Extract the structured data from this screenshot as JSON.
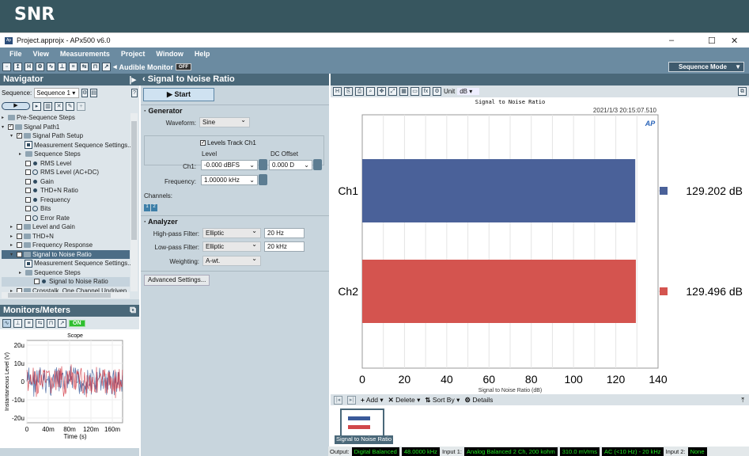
{
  "banner": "SNR",
  "window": {
    "title": "Project.approjx - APx500 v6.0",
    "app_icon": "Ap",
    "min": "–",
    "max": "☐",
    "close": "✕"
  },
  "menu": [
    "File",
    "View",
    "Measurements",
    "Project",
    "Window",
    "Help"
  ],
  "toolbar": {
    "audible_monitor": "Audible Monitor",
    "audible_state": "OFF",
    "mode": "Sequence Mode"
  },
  "navigator": {
    "title": "Navigator",
    "sequence_label": "Sequence:",
    "sequence_value": "Sequence 1",
    "tree": [
      {
        "label": "Pre-Sequence Steps",
        "indent": 0,
        "type": "folder",
        "exp": "▸"
      },
      {
        "label": "Signal Path1",
        "indent": 0,
        "type": "folder",
        "exp": "▾",
        "check": "✓"
      },
      {
        "label": "Signal Path Setup",
        "indent": 1,
        "type": "folder",
        "exp": "▾",
        "check": "✓"
      },
      {
        "label": "Measurement Sequence Settings...",
        "indent": 2,
        "type": "gear"
      },
      {
        "label": "Sequence Steps",
        "indent": 2,
        "type": "folder",
        "exp": "▸",
        "nocheck": true
      },
      {
        "label": "RMS Level",
        "indent": 2,
        "type": "dot",
        "check": ""
      },
      {
        "label": "RMS Level (AC+DC)",
        "indent": 2,
        "type": "no",
        "check": ""
      },
      {
        "label": "Gain",
        "indent": 2,
        "type": "dot",
        "check": ""
      },
      {
        "label": "THD+N Ratio",
        "indent": 2,
        "type": "dot",
        "check": ""
      },
      {
        "label": "Frequency",
        "indent": 2,
        "type": "dot",
        "check": ""
      },
      {
        "label": "Bits",
        "indent": 2,
        "type": "no",
        "check": ""
      },
      {
        "label": "Error Rate",
        "indent": 2,
        "type": "no",
        "check": ""
      },
      {
        "label": "Level and Gain",
        "indent": 1,
        "type": "folder",
        "exp": "▸",
        "check": ""
      },
      {
        "label": "THD+N",
        "indent": 1,
        "type": "folder",
        "exp": "▸",
        "check": ""
      },
      {
        "label": "Frequency Response",
        "indent": 1,
        "type": "folder",
        "exp": "▸",
        "check": ""
      },
      {
        "label": "Signal to Noise Ratio",
        "indent": 1,
        "type": "folder",
        "exp": "▾",
        "check": "",
        "state": "sel"
      },
      {
        "label": "Measurement Sequence Settings...",
        "indent": 2,
        "type": "gear"
      },
      {
        "label": "Sequence Steps",
        "indent": 2,
        "type": "folder",
        "exp": "▸",
        "nocheck": true
      },
      {
        "label": "Signal to Noise Ratio",
        "indent": 3,
        "type": "dot",
        "check": "",
        "state": "hl"
      },
      {
        "label": "Crosstalk, One Channel Undriven",
        "indent": 1,
        "type": "folder",
        "exp": "▸",
        "check": ""
      }
    ]
  },
  "monitors": {
    "title": "Monitors/Meters",
    "on_label": "ON",
    "scope": {
      "title": "Scope",
      "ylabel": "Instantaneous Level (V)",
      "xlabel": "Time (s)",
      "yticks": [
        "20u",
        "10u",
        "0",
        "-10u",
        "-20u"
      ],
      "xticks": [
        "0",
        "40m",
        "80m",
        "120m",
        "160m"
      ],
      "colors": [
        "#3a5a9a",
        "#d0343f"
      ]
    }
  },
  "measurement": {
    "title": "Signal to Noise Ratio",
    "start": "Start",
    "generator": {
      "heading": "Generator",
      "waveform_label": "Waveform:",
      "waveform": "Sine",
      "levels_track": "Levels Track Ch1",
      "levels_track_checked": true,
      "level_header": "Level",
      "dc_header": "DC Offset",
      "ch1_label": "Ch1:",
      "ch1_level": "-0.000 dBFS",
      "ch1_dc": "0.000 D",
      "freq_label": "Frequency:",
      "freq": "1.00000 kHz",
      "channels_label": "Channels:",
      "channels": [
        "1",
        "2"
      ]
    },
    "analyzer": {
      "heading": "Analyzer",
      "hp_label": "High-pass Filter:",
      "hp_type": "Elliptic",
      "hp_value": "20 Hz",
      "lp_label": "Low-pass Filter:",
      "lp_type": "Elliptic",
      "lp_value": "20 kHz",
      "weight_label": "Weighting:",
      "weight": "A-wt."
    },
    "advanced": "Advanced Settings..."
  },
  "graph": {
    "unit_label": "Unit",
    "unit": "dB",
    "timestamp": "2021/1/3 20:15:07.510",
    "logo": "AP"
  },
  "chart_data": {
    "type": "bar",
    "orientation": "horizontal",
    "title": "Signal to Noise Ratio",
    "categories": [
      "Ch1",
      "Ch2"
    ],
    "values": [
      129.202,
      129.496
    ],
    "value_labels": [
      "129.202 dB",
      "129.496 dB"
    ],
    "colors": [
      "#4a6199",
      "#d4544f"
    ],
    "xlabel": "Signal to Noise Ratio (dB)",
    "xlim": [
      0,
      140
    ],
    "xticks": [
      "0",
      "20",
      "40",
      "60",
      "80",
      "100",
      "120",
      "140"
    ],
    "grid": true
  },
  "results": {
    "add": "Add",
    "delete": "Delete",
    "sort": "Sort By",
    "details": "Details",
    "thumb": "Signal to Noise Ratio"
  },
  "status": {
    "output_label": "Output:",
    "output": "Digital Balanced",
    "rate": "48.0000 kHz",
    "input1_label": "Input 1:",
    "input1": "Analog Balanced 2 Ch, 200 kohm",
    "level": "310.0 mVrms",
    "bw": "AC (<10 Hz) - 20 kHz",
    "input2_label": "Input 2:",
    "input2": "None"
  }
}
